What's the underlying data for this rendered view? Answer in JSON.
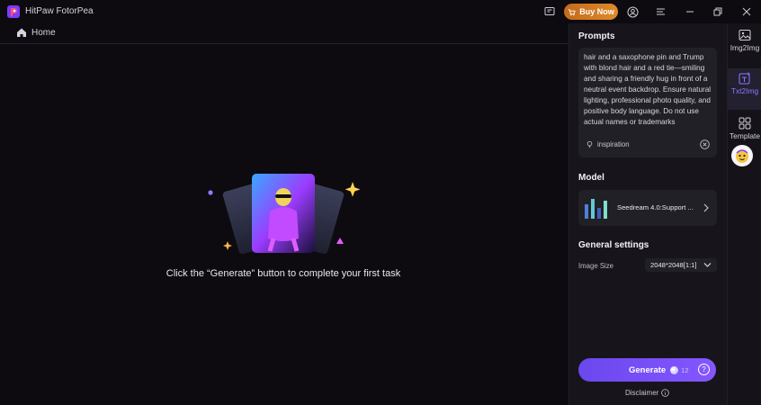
{
  "app": {
    "title": "HitPaw FotorPea",
    "buy_now": "Buy Now"
  },
  "nav": {
    "home": "Home"
  },
  "main": {
    "hint": "Click the “Generate” button to complete your first task"
  },
  "panel": {
    "prompts_title": "Prompts",
    "prompt_text": "hair and a saxophone pin and Trump with blond hair and a red tie—smiling and sharing a friendly hug in front of a neutral event backdrop. Ensure natural lighting, professional photo quality, and positive body language. Do not use actual names or trademarks",
    "inspiration": "inspiration",
    "model_title": "Model",
    "model_name": "Seedream 4.0:Support ...",
    "general_title": "General settings",
    "image_size_label": "Image Size",
    "image_size_value": "2048*2048[1:1]",
    "generate": "Generate",
    "credits": "12",
    "disclaimer": "Disclaimer"
  },
  "tools": [
    {
      "label": "Img2Img",
      "icon": "image-icon"
    },
    {
      "label": "Txt2Img",
      "icon": "text-image-icon"
    },
    {
      "label": "Template",
      "icon": "template-grid-icon"
    }
  ],
  "colors": {
    "accent": "#7c5cff",
    "buy": "#d97b22",
    "panel": "#17151b",
    "bg": "#0d0b10"
  }
}
